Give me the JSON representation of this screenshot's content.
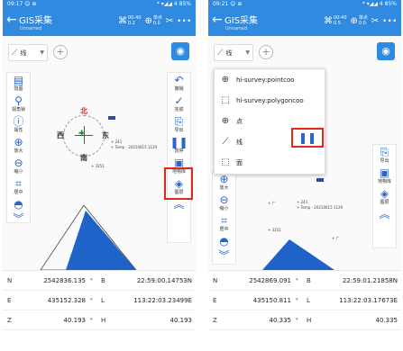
{
  "left": {
    "status": {
      "time": "09:17 ☺ ⊕",
      "signal": "* ▾◢◢ 4 85%"
    },
    "header": {
      "title": "GIS采集",
      "subtitle": "Unnamed",
      "icon1_top": "00-40",
      "icon1_bottom": "0.2",
      "icon2_top": "单点",
      "icon2_bottom": "0.0"
    },
    "layer": {
      "value": "线"
    },
    "left_tools": [
      "隐图",
      "视角锁",
      "属性",
      "放大",
      "缩小",
      "居中",
      ""
    ],
    "right_tools": [
      "撤销",
      "完成",
      "导出",
      "暂停",
      "地物库",
      "图层",
      ""
    ],
    "compass": {
      "n": "北",
      "s": "南",
      "e": "东",
      "w": "西"
    },
    "map_labels": {
      "p1": "+  241",
      "p2": "+ Temp - 20210615 1129",
      "p3": "+ 3251"
    },
    "coords": {
      "N": "2542836.135",
      "E": "435152.328",
      "Z": "40.193",
      "B": "22:59:00.14753N",
      "L": "113:22:03.23499E",
      "H": "40.193"
    }
  },
  "right": {
    "status": {
      "time": "09:21 ☺ ⊕",
      "signal": "* ▾◢◢ 4 85%"
    },
    "header": {
      "title": "GIS采集",
      "subtitle": "Unnamed",
      "icon1_top": "00-40",
      "icon1_bottom": "0.5",
      "icon2_top": "单点",
      "icon2_bottom": "0.0"
    },
    "layer": {
      "value": "线"
    },
    "popup": [
      "hi-survey:pointcoo",
      "hi-survey:polygoncoo",
      "点",
      "线",
      "面"
    ],
    "left_tools": [
      "放大",
      "缩小",
      "居中",
      ""
    ],
    "right_tools": [
      "导出",
      "地物库",
      "图层",
      ""
    ],
    "map_labels": {
      "p0": "+ 广",
      "p1": "+  241",
      "p2": "+ Temp - 20210615 1129",
      "p3": "+ 3251",
      "p4": "+ 广"
    },
    "coords": {
      "N": "2542869.091",
      "E": "435150.811",
      "Z": "40.335",
      "B": "22:59:01.21858N",
      "L": "113:22:03.17673E",
      "H": "40.335"
    }
  },
  "labels": {
    "N": "N",
    "E": "E",
    "Z": "Z",
    "B": "B",
    "L": "L",
    "H": "H",
    "dd": "▾"
  }
}
